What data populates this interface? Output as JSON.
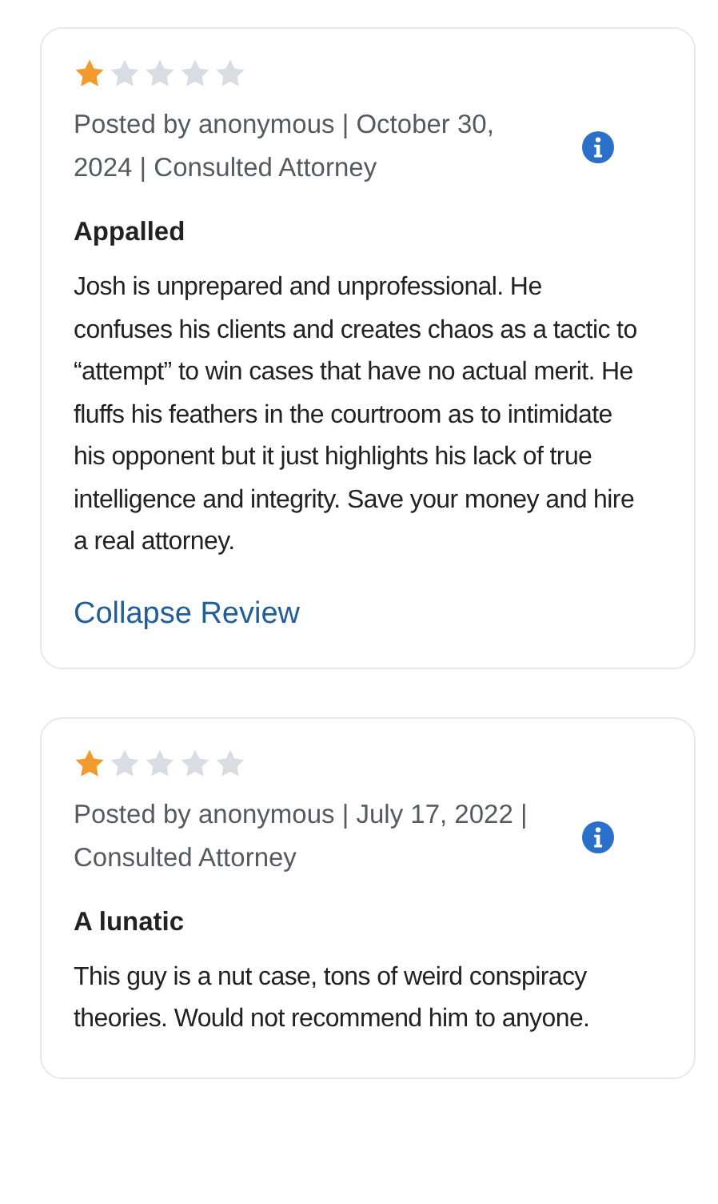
{
  "reviews": [
    {
      "stars": 1,
      "meta": "Posted by anonymous | October 30, 2024 | Consulted Attorney",
      "title": "Appalled",
      "body": "Josh is unprepared and unprofessional. He confuses his clients and creates chaos as a tactic to “attempt” to win cases that have no actual merit. He fluffs his feathers in the courtroom as to intimidate his opponent but it just highlights his lack of true intelligence and integrity. Save your money and hire a real attorney.",
      "link": "Collapse Review"
    },
    {
      "stars": 1,
      "meta": "Posted by anonymous | July 17, 2022 | Consulted Attorney",
      "title": "A lunatic",
      "body": "This guy is a nut case, tons of weird conspiracy theories. Would not recommend him to anyone."
    }
  ]
}
